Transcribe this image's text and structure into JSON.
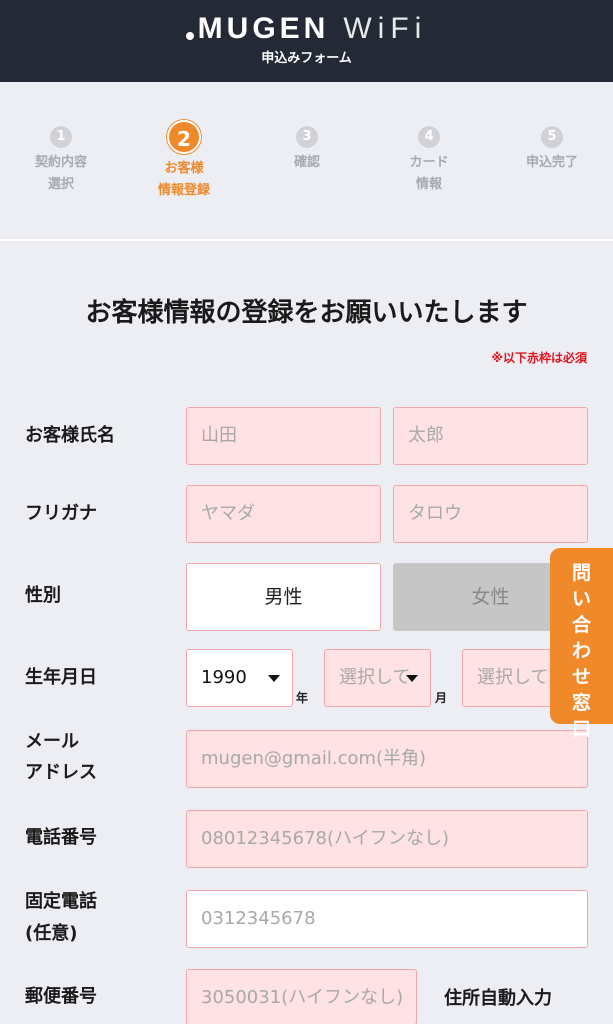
{
  "header": {
    "logo_brand": "MUGEN",
    "logo_wifi": "WiFi",
    "subtitle": "申込みフォーム"
  },
  "steps": [
    {
      "number": "1",
      "line1": "契約内容",
      "line2": "選択",
      "active": false
    },
    {
      "number": "2",
      "line1": "お客様",
      "line2": "情報登録",
      "active": true
    },
    {
      "number": "3",
      "line1": "確認",
      "line2": "",
      "active": false
    },
    {
      "number": "4",
      "line1": "カード",
      "line2": "情報",
      "active": false
    },
    {
      "number": "5",
      "line1": "申込完了",
      "line2": "",
      "active": false
    }
  ],
  "form": {
    "title": "お客様情報の登録をお願いいたします",
    "required_note": "※以下赤枠は必須",
    "name": {
      "label": "お客様氏名",
      "last_placeholder": "山田",
      "first_placeholder": "太郎"
    },
    "furigana": {
      "label": "フリガナ",
      "last_placeholder": "ヤマダ",
      "first_placeholder": "タロウ"
    },
    "gender": {
      "label": "性別",
      "male": "男性",
      "female": "女性"
    },
    "birthdate": {
      "label": "生年月日",
      "year_value": "1990",
      "year_unit": "年",
      "month_placeholder": "選択して",
      "month_unit": "月",
      "day_placeholder": "選択して"
    },
    "email": {
      "label_line1": "メール",
      "label_line2": "アドレス",
      "placeholder": "mugen@gmail.com(半角)"
    },
    "phone": {
      "label": "電話番号",
      "placeholder": "08012345678(ハイフンなし)"
    },
    "landline": {
      "label_line1": "固定電話",
      "label_line2": "(任意)",
      "placeholder": "0312345678"
    },
    "postal": {
      "label": "郵便番号",
      "placeholder": "3050031(ハイフンなし)",
      "auto_fill": "住所自動入力"
    }
  },
  "contact_tab": {
    "chars": [
      "問",
      "い",
      "合",
      "わ",
      "せ",
      "窓",
      "口"
    ]
  },
  "colors": {
    "accent": "#f0892a",
    "header_bg": "#232a36",
    "required_border": "#f0a6aa",
    "required_bg": "#ffe2e3",
    "required_text": "#e0121b"
  }
}
